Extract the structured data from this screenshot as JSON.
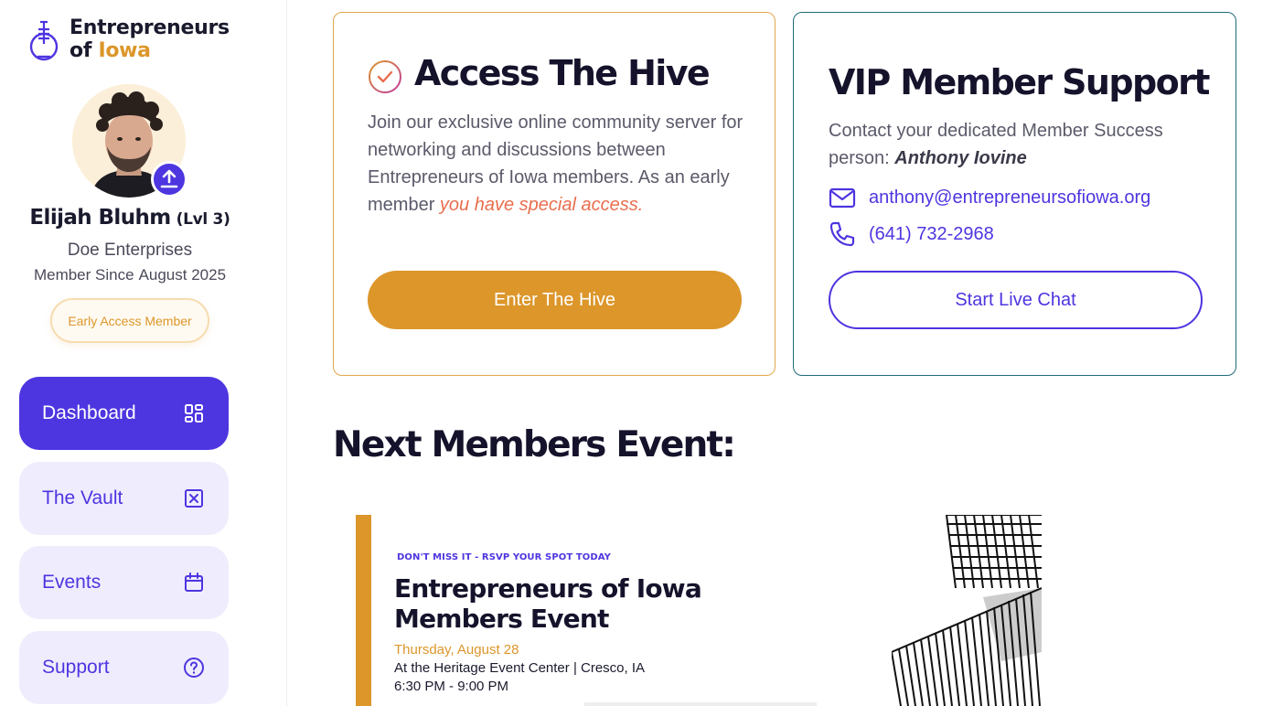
{
  "brand": {
    "line1": "Entrepreneurs",
    "line2_prefix": "of ",
    "line2_accent": "Iowa",
    "accent_color": "#dc962a",
    "primary_color": "#4d35e0"
  },
  "profile": {
    "name": "Elijah Bluhm",
    "level": "(Lvl 3)",
    "company": "Doe Enterprises",
    "member_since_label": "Member Since",
    "member_since_date": "August 2025",
    "badge": "Early Access Member",
    "upload_icon": "upload-icon"
  },
  "nav": {
    "items": [
      {
        "label": "Dashboard",
        "icon": "grid-icon",
        "active": true
      },
      {
        "label": "The Vault",
        "icon": "vault-icon",
        "active": false
      },
      {
        "label": "Events",
        "icon": "calendar-icon",
        "active": false
      },
      {
        "label": "Support",
        "icon": "help-icon",
        "active": false
      }
    ]
  },
  "hive_card": {
    "title": "Access The Hive",
    "description": "Join our exclusive online community server for networking and discussions between Entrepreneurs of Iowa members. As an early member ",
    "highlight": "you have special access.",
    "button": "Enter The Hive"
  },
  "vip_card": {
    "title": "VIP Member Support",
    "description": "Contact your dedicated Member Success person: ",
    "person": "Anthony Iovine",
    "email": "anthony@entrepreneursofiowa.org",
    "phone": "(641) 732-2968",
    "button": "Start Live Chat"
  },
  "next_event": {
    "heading": "Next Members Event:",
    "kicker": "DON'T MISS IT - RSVP YOUR SPOT TODAY",
    "title": "Entrepreneurs of Iowa Members Event",
    "date": "Thursday, August 28",
    "location": "At the Heritage Event Center | Cresco, IA",
    "time": "6:30 PM - 9:00 PM"
  }
}
